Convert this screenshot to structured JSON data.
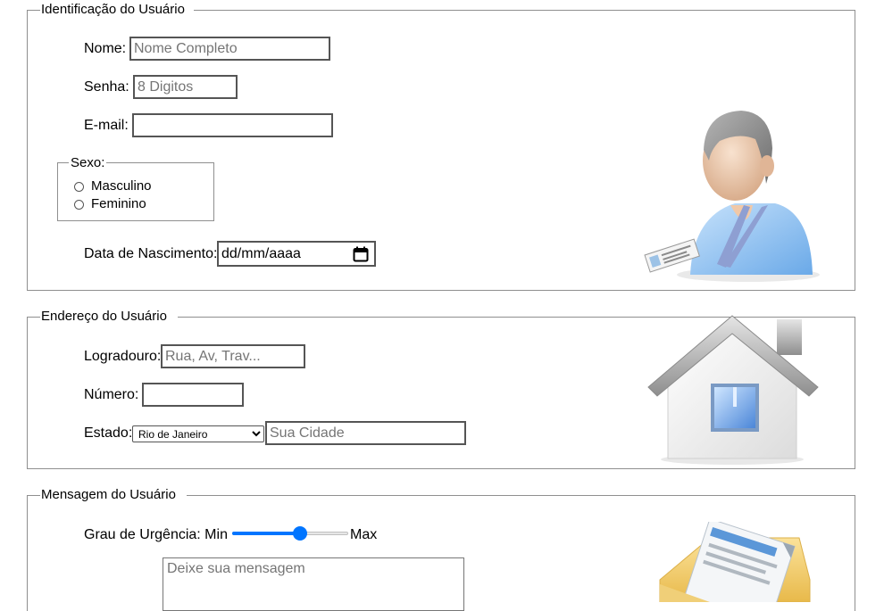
{
  "identificacao": {
    "legend": "Identificação do Usuário",
    "nome_label": "Nome:",
    "nome_placeholder": "Nome Completo",
    "senha_label": "Senha:",
    "senha_placeholder": "8 Digitos",
    "email_label": "E-mail:",
    "sexo": {
      "legend": "Sexo:",
      "options": [
        "Masculino",
        "Feminino"
      ]
    },
    "nascimento_label": "Data de Nascimento:",
    "nascimento_placeholder": "dd/mm/aaaa",
    "image_icon": "user-badge-icon"
  },
  "endereco": {
    "legend": "Endereço do Usuário",
    "logradouro_label": "Logradouro:",
    "logradouro_placeholder": "Rua, Av, Trav...",
    "numero_label": "Número:",
    "estado_label": "Estado:",
    "estado_selected": "Rio de Janeiro",
    "cidade_placeholder": "Sua Cidade",
    "image_icon": "house-icon"
  },
  "mensagem": {
    "legend": "Mensagem do Usuário",
    "urgencia_label": "Grau de Urgência: Min",
    "urgencia_max": "Max",
    "urgencia_value": 0.6,
    "mensagem_placeholder": "Deixe sua mensagem",
    "image_icon": "mail-envelope-icon"
  },
  "colors": {
    "accent": "#0075ff",
    "border": "#8f8f8f"
  }
}
